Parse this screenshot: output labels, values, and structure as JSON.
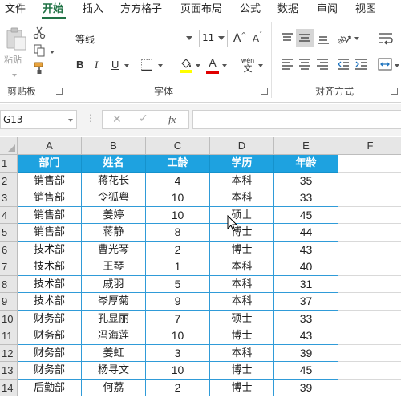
{
  "menu": {
    "tabs": [
      {
        "label": "文件",
        "active": false
      },
      {
        "label": "开始",
        "active": true
      },
      {
        "label": "插入",
        "active": false
      },
      {
        "label": "方方格子",
        "active": false
      },
      {
        "label": "页面布局",
        "active": false
      },
      {
        "label": "公式",
        "active": false
      },
      {
        "label": "数据",
        "active": false
      },
      {
        "label": "审阅",
        "active": false
      },
      {
        "label": "视图",
        "active": false
      }
    ]
  },
  "ribbon": {
    "clipboard": {
      "paste_label": "粘贴",
      "group_label": "剪贴板",
      "icons": [
        "paste-icon",
        "cut-icon",
        "copy-icon",
        "format-painter-icon"
      ]
    },
    "font": {
      "font_name": "等线",
      "font_size": "11",
      "bold_label": "B",
      "italic_label": "I",
      "underline_label": "U",
      "grow_label": "A",
      "shrink_label": "A",
      "font_color_label": "A",
      "phonetic_label": "wén",
      "phonetic_sub": "文",
      "group_label": "字体",
      "fill_color": "#ffff00",
      "font_color": "#e00000"
    },
    "alignment": {
      "group_label": "对齐方式"
    }
  },
  "formula_bar": {
    "name_box": "G13",
    "fx_label": "fx",
    "formula": ""
  },
  "grid": {
    "columns": [
      "A",
      "B",
      "C",
      "D",
      "E",
      "F"
    ],
    "rows": [
      "1",
      "2",
      "3",
      "4",
      "5",
      "6",
      "7",
      "8",
      "9",
      "10",
      "11",
      "12",
      "13",
      "14"
    ],
    "header_fill": "#1ea2e0",
    "table_header": [
      "部门",
      "姓名",
      "工龄",
      "学历",
      "年龄"
    ],
    "table_rows": [
      [
        "销售部",
        "蒋花长",
        "4",
        "本科",
        "35"
      ],
      [
        "销售部",
        "令狐粤",
        "10",
        "本科",
        "33"
      ],
      [
        "销售部",
        "姜婷",
        "10",
        "硕士",
        "45"
      ],
      [
        "销售部",
        "蒋静",
        "8",
        "博士",
        "44"
      ],
      [
        "技术部",
        "曹光琴",
        "2",
        "博士",
        "43"
      ],
      [
        "技术部",
        "王琴",
        "1",
        "本科",
        "40"
      ],
      [
        "技术部",
        "戚羽",
        "5",
        "本科",
        "31"
      ],
      [
        "技术部",
        "岑厚菊",
        "9",
        "本科",
        "37"
      ],
      [
        "财务部",
        "孔显丽",
        "7",
        "硕士",
        "33"
      ],
      [
        "财务部",
        "冯海莲",
        "10",
        "博士",
        "43"
      ],
      [
        "财务部",
        "姜虹",
        "3",
        "本科",
        "39"
      ],
      [
        "财务部",
        "杨寻文",
        "10",
        "博士",
        "45"
      ],
      [
        "后勤部",
        "何荔",
        "2",
        "博士",
        "39"
      ]
    ]
  }
}
